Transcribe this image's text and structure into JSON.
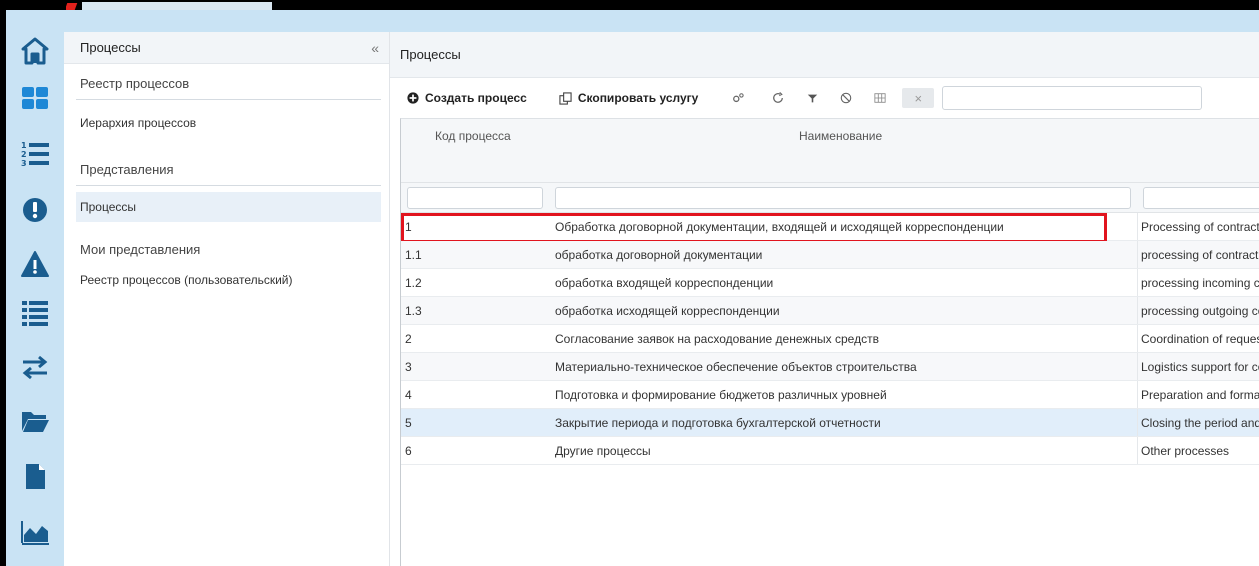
{
  "sidebar": {
    "title": "Процессы",
    "collapse_icon": "double-chevron-left-icon",
    "collapse_glyph": "«",
    "sections": [
      {
        "label": "Реестр процессов",
        "items": [
          "Иерархия процессов"
        ]
      },
      {
        "label": "Представления",
        "items": [
          "Процессы"
        ]
      },
      {
        "label": "Мои представления",
        "items": [
          "Реестр процессов (пользовательский)"
        ]
      }
    ]
  },
  "iconbar": {
    "icons": [
      "home-icon",
      "dashboard-icon",
      "numbered-list-icon",
      "alert-circle-icon",
      "warning-icon",
      "list-icon",
      "transfer-icon",
      "folder-icon",
      "document-icon",
      "area-chart-icon"
    ]
  },
  "main": {
    "title": "Процессы",
    "toolbar": {
      "create_label": "Создать процесс",
      "copy_label": "Скопировать услугу",
      "icons": [
        "settings-icon",
        "refresh-icon",
        "filter-icon",
        "cancel-icon",
        "columns-icon"
      ],
      "clear_glyph": "×"
    },
    "grid": {
      "columns": [
        "Код процесса",
        "Наименование",
        ""
      ],
      "rows": [
        {
          "code": "1",
          "name": "Обработка договорной документации, входящей и исходящей корреспонденции",
          "name_en": "Processing of contractu"
        },
        {
          "code": "1.1",
          "name": "обработка договорной документации",
          "name_en": "processing of contract c"
        },
        {
          "code": "1.2",
          "name": "обработка входящей корреспонденции",
          "name_en": "processing incoming co"
        },
        {
          "code": "1.3",
          "name": "обработка исходящей корреспонденции",
          "name_en": "processing outgoing co"
        },
        {
          "code": "2",
          "name": "Согласование заявок на расходование денежных средств",
          "name_en": "Coordination of request"
        },
        {
          "code": "3",
          "name": "Материально-техническое обеспечение объектов строительства",
          "name_en": "Logistics support for co"
        },
        {
          "code": "4",
          "name": "Подготовка и формирование бюджетов различных уровней",
          "name_en": "Preparation and formati"
        },
        {
          "code": "5",
          "name": "Закрытие периода и подготовка бухгалтерской отчетности",
          "name_en": "Closing the period and p"
        },
        {
          "code": "6",
          "name": "Другие процессы",
          "name_en": "Other processes"
        }
      ],
      "selected_row": "5",
      "highlighted_row": "1"
    }
  },
  "colors": {
    "nav_bg": "#c9e3f4",
    "icon_color": "#1a5d8f",
    "highlight": "#e1141e",
    "selected_row": "#e1eefa"
  }
}
